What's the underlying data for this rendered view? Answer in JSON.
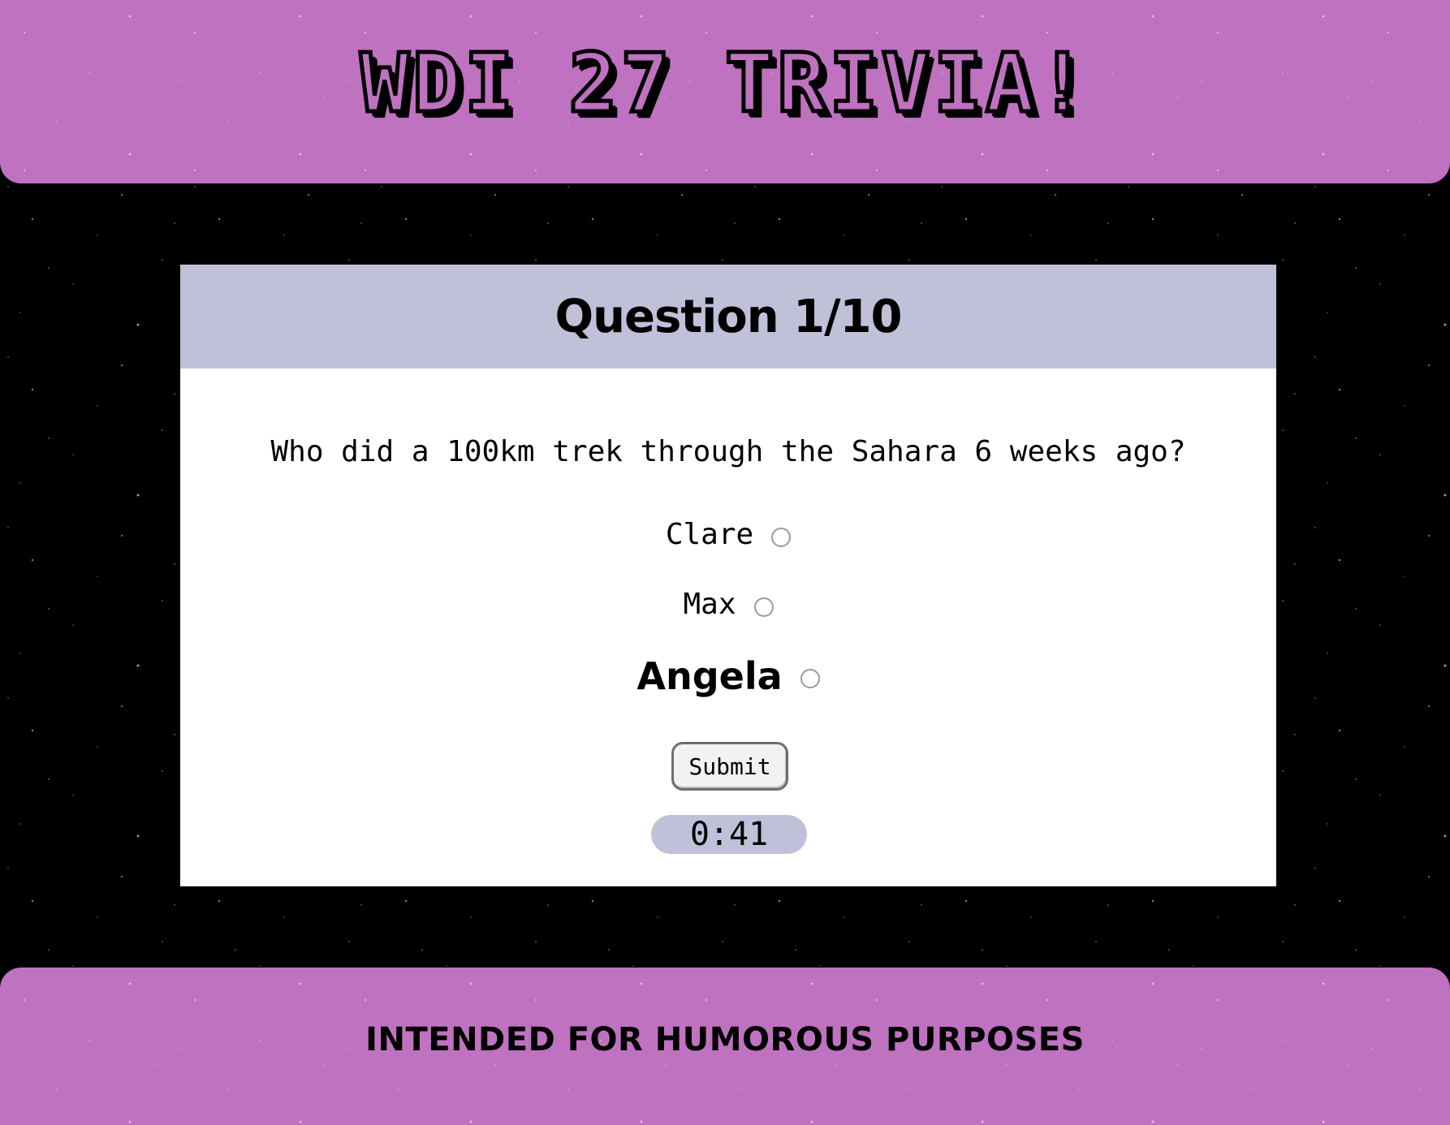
{
  "header": {
    "title": "WDI 27 TRIVIA!"
  },
  "quiz": {
    "question_label": "Question 1/10",
    "question_text": "Who did a 100km trek through the Sahara 6 weeks ago?",
    "answers": [
      {
        "label": "Clare",
        "selected": false
      },
      {
        "label": "Max",
        "selected": false
      },
      {
        "label": "Angela",
        "selected": false
      }
    ],
    "submit_label": "Submit",
    "timer": "0:41"
  },
  "footer": {
    "text": "INTENDED FOR HUMOROUS PURPOSES"
  },
  "colors": {
    "banner": "#bf72c0",
    "question_header": "#c0c1d8",
    "background": "#000000",
    "card": "#ffffff"
  }
}
